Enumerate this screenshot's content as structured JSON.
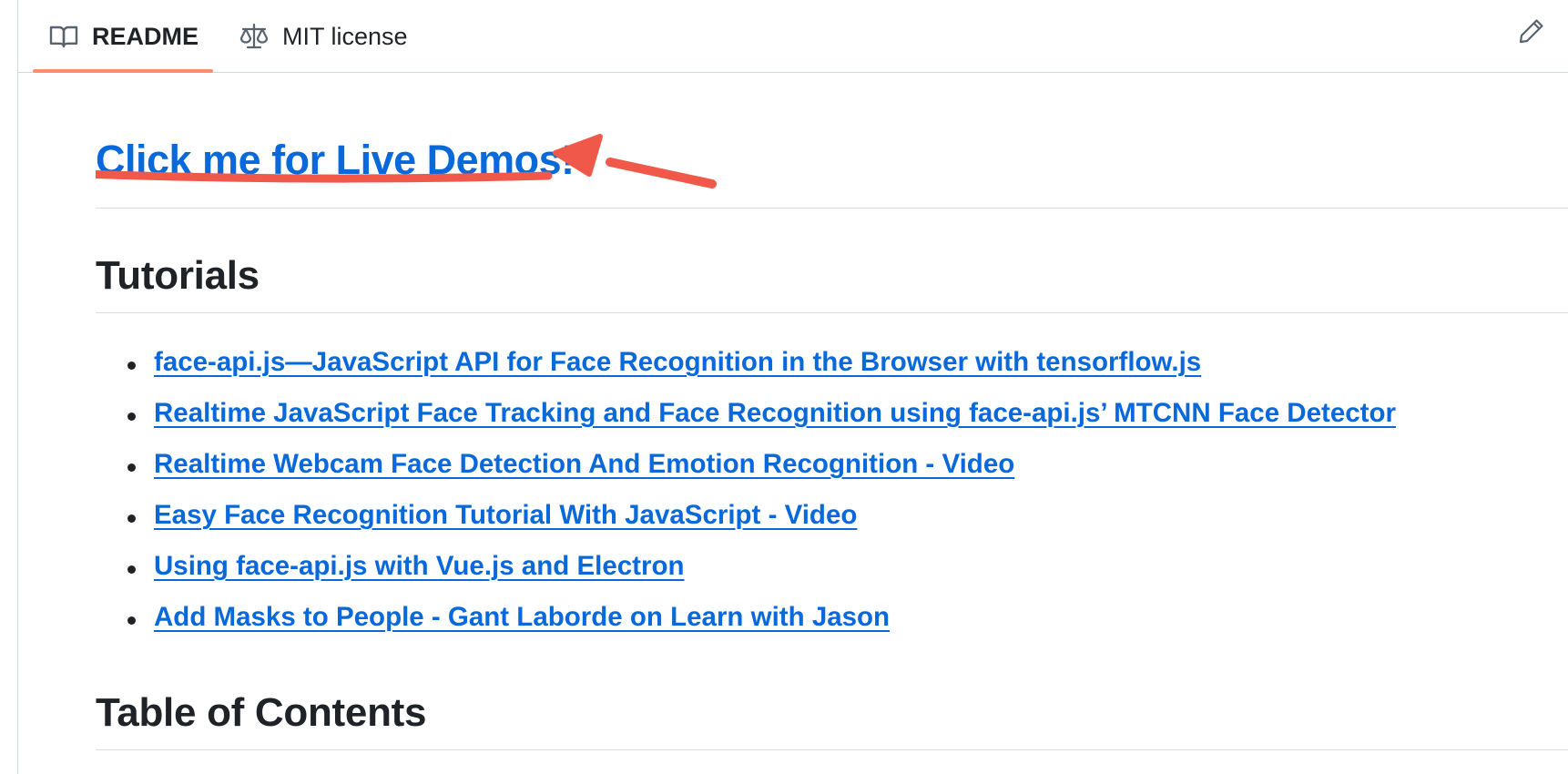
{
  "tabs": [
    {
      "label": "README",
      "icon": "book-icon",
      "active": true
    },
    {
      "label": "MIT license",
      "icon": "scale-icon",
      "active": false
    }
  ],
  "toolbar": {
    "edit_icon": "pencil-icon"
  },
  "readme": {
    "demo_link": "Click me for Live Demos!",
    "tutorials_heading": "Tutorials",
    "tutorials": [
      "face-api.js—JavaScript API for Face Recognition in the Browser with tensorflow.js",
      "Realtime JavaScript Face Tracking and Face Recognition using face-api.js’ MTCNN Face Detector",
      "Realtime Webcam Face Detection And Emotion Recognition - Video",
      "Easy Face Recognition Tutorial With JavaScript - Video",
      "Using face-api.js with Vue.js and Electron",
      "Add Masks to People - Gant Laborde on Learn with Jason"
    ],
    "toc_heading": "Table of Contents"
  },
  "colors": {
    "link": "#0969da",
    "active_tab_underline": "#fd8c73",
    "annotation": "#f0584a"
  }
}
